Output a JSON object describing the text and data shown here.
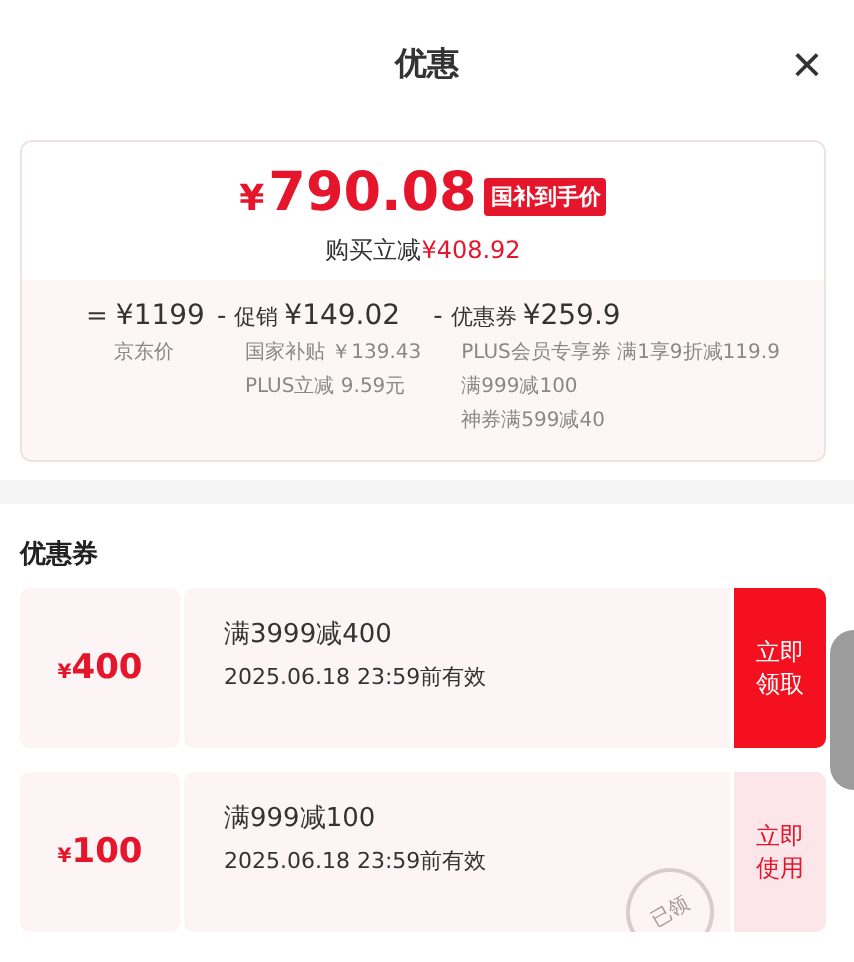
{
  "header": {
    "title": "优惠",
    "close": "×"
  },
  "summary": {
    "price": "790.08",
    "currency": "¥",
    "badge": "国补到手价",
    "saving_label": "购买立减",
    "saving": "¥408.92",
    "breakdown": [
      {
        "op": "=",
        "amount": "¥1199",
        "notes": [
          "京东价"
        ]
      },
      {
        "op": "-",
        "label": "促销",
        "amount": "¥149.02",
        "notes": [
          "国家补贴 ￥139.43",
          "PLUS立减 9.59元"
        ]
      },
      {
        "op": "-",
        "label": "优惠券",
        "amount": "¥259.9",
        "notes": [
          "PLUS会员专享券 满1享9折减119.9",
          "满999减100",
          "神券满599减40"
        ]
      }
    ]
  },
  "coupons": {
    "title": "优惠券",
    "items": [
      {
        "currency": "¥",
        "value": "400",
        "condition": "满3999减400",
        "validity": "2025.06.18 23:59前有效",
        "action": "立即领取",
        "claimed": false
      },
      {
        "currency": "¥",
        "value": "100",
        "condition": "满999减100",
        "validity": "2025.06.18 23:59前有效",
        "action": "立即使用",
        "claimed": true,
        "stamp": "已领"
      }
    ]
  }
}
